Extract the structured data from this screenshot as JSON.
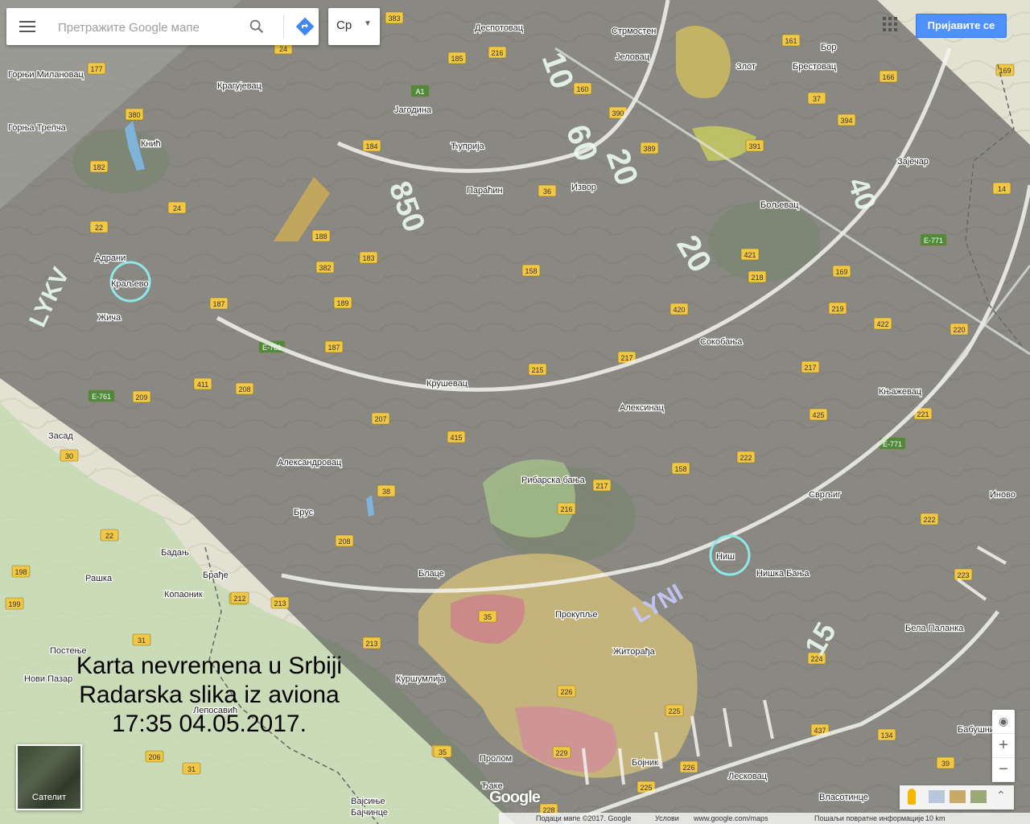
{
  "search": {
    "placeholder": "Претражите Google мапе"
  },
  "language": {
    "selected": "Ср"
  },
  "header": {
    "signin_label": "Пријавите се"
  },
  "caption": {
    "line1": "Karta nevremena u Srbiji",
    "line2": "Radarska slika iz aviona",
    "line3": "17:35 04.05.2017."
  },
  "satellite_toggle": {
    "label": "Сателит"
  },
  "zoom": {
    "in": "+",
    "out": "−"
  },
  "attribution": {
    "data": "Подаци мапе ©2017. Google",
    "terms": "Услови",
    "site": "www.google.com/maps",
    "feedback": "Пошаљи повратне информације",
    "scale": "10 km"
  },
  "logo": {
    "text": "Google"
  },
  "cities": [
    {
      "name": "Деспотовац"
    },
    {
      "name": "Стрмостен"
    },
    {
      "name": "Бор"
    },
    {
      "name": "Крагујевац"
    },
    {
      "name": "Јагодина"
    },
    {
      "name": "Јеловац"
    },
    {
      "name": "Злот"
    },
    {
      "name": "Брестовац"
    },
    {
      "name": "Ћуприја"
    },
    {
      "name": "Параћин"
    },
    {
      "name": "Извор"
    },
    {
      "name": "Зајечар"
    },
    {
      "name": "Бољевац"
    },
    {
      "name": "Краљево"
    },
    {
      "name": "Адрани"
    },
    {
      "name": "Жича"
    },
    {
      "name": "Сокобања"
    },
    {
      "name": "Крушевац"
    },
    {
      "name": "Алексинац"
    },
    {
      "name": "Књажевац"
    },
    {
      "name": "Александровац"
    },
    {
      "name": "Рибарска бања"
    },
    {
      "name": "Брус"
    },
    {
      "name": "Сврљиг"
    },
    {
      "name": "Иново"
    },
    {
      "name": "Ниш"
    },
    {
      "name": "Нишка Бања"
    },
    {
      "name": "Бадањ"
    },
    {
      "name": "Рашка"
    },
    {
      "name": "Брађе"
    },
    {
      "name": "Копаоник"
    },
    {
      "name": "Блаце"
    },
    {
      "name": "Прокупље"
    },
    {
      "name": "Бела Паланка"
    },
    {
      "name": "Житорађа"
    },
    {
      "name": "Постење"
    },
    {
      "name": "Нови Пазар"
    },
    {
      "name": "Куршумлија"
    },
    {
      "name": "Бабушница"
    },
    {
      "name": "Бојник"
    },
    {
      "name": "Пролом"
    },
    {
      "name": "Лесковац"
    },
    {
      "name": "Власотинце"
    },
    {
      "name": "Засад"
    },
    {
      "name": "Горњи Милановац"
    },
    {
      "name": "Горња Трепча"
    },
    {
      "name": "Кнић"
    },
    {
      "name": "Ђаке"
    },
    {
      "name": "Вајсиње"
    },
    {
      "name": "Бајчинце"
    },
    {
      "name": "Лепосавић"
    }
  ],
  "roads": [
    "383",
    "185",
    "216",
    "24",
    "177",
    "380",
    "A1",
    "160",
    "390",
    "389",
    "184",
    "382",
    "188",
    "183",
    "189",
    "187",
    "158",
    "36",
    "421",
    "218",
    "420",
    "187",
    "217",
    "215",
    "E-761",
    "411",
    "208",
    "209",
    "207",
    "415",
    "38",
    "208",
    "217",
    "222",
    "158",
    "216",
    "35",
    "213",
    "212",
    "22",
    "198",
    "199",
    "31",
    "213",
    "35",
    "226",
    "225",
    "224",
    "229",
    "225",
    "226",
    "437",
    "134",
    "39",
    "206",
    "31",
    "35",
    "228",
    "161",
    "37",
    "166",
    "169",
    "394",
    "391",
    "14",
    "E-771",
    "169",
    "219",
    "422",
    "220",
    "221",
    "425",
    "217",
    "E-771",
    "E-761",
    "22",
    "30",
    "182",
    "24",
    "212",
    "223",
    "222"
  ],
  "radar_labels": [
    "LYKV",
    "LYNI",
    "40",
    "15",
    "20",
    "10",
    "60",
    "850",
    "20"
  ]
}
